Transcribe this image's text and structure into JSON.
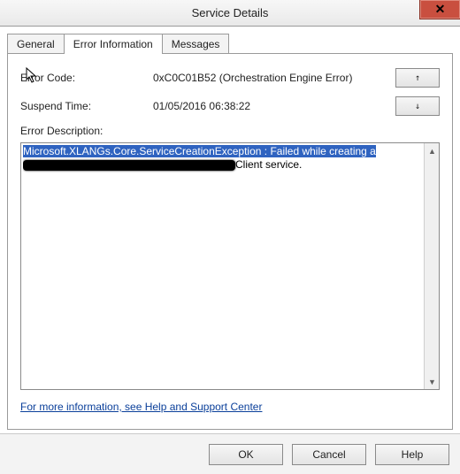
{
  "window": {
    "title": "Service Details"
  },
  "tabs": {
    "general": "General",
    "error_info": "Error Information",
    "messages": "Messages"
  },
  "labels": {
    "error_code": "Error Code:",
    "suspend_time": "Suspend Time:",
    "error_description": "Error Description:"
  },
  "values": {
    "error_code": "0xC0C01B52 (Orchestration Engine Error)",
    "suspend_time": "01/05/2016 06:38:22"
  },
  "nav": {
    "prev": "↑",
    "next": "↓"
  },
  "description": {
    "line1": "Microsoft.XLANGs.Core.ServiceCreationException : Failed while creating a",
    "line2_suffix": "Client service."
  },
  "help_link": "For more information, see Help and Support Center",
  "buttons": {
    "ok": "OK",
    "cancel": "Cancel",
    "help": "Help"
  },
  "close_glyph": "✕"
}
